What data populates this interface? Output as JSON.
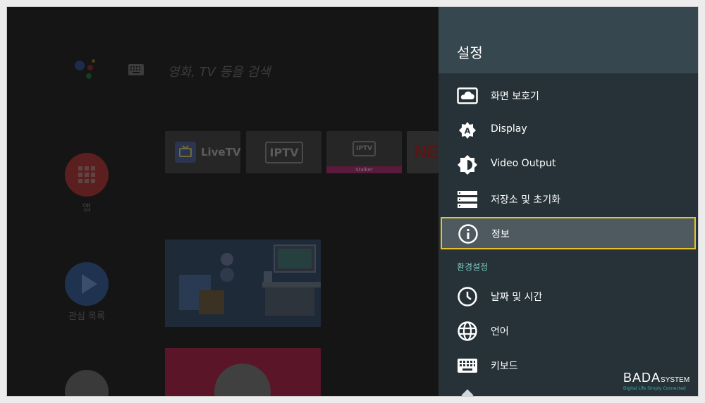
{
  "home": {
    "search_placeholder": "영화, TV 등을 검색",
    "apps_label": "앱",
    "favorites_label": "관심 목록",
    "tiles": {
      "livetv": "LiveTV",
      "iptv": "IPTV",
      "stalker_logo": "IPTV",
      "stalker_label": "Stalker",
      "netflix": "NETF"
    }
  },
  "settings": {
    "title": "설정",
    "items": [
      {
        "label": "화면 보호기",
        "icon": "screensaver-icon"
      },
      {
        "label": "Display",
        "icon": "display-icon"
      },
      {
        "label": "Video Output",
        "icon": "brightness-icon"
      },
      {
        "label": "저장소 및 초기화",
        "icon": "storage-icon"
      },
      {
        "label": "정보",
        "icon": "info-icon",
        "focused": true
      }
    ],
    "section_label": "환경설정",
    "pref_items": [
      {
        "label": "날짜 및 시간",
        "icon": "clock-icon"
      },
      {
        "label": "언어",
        "icon": "globe-icon"
      },
      {
        "label": "키보드",
        "icon": "keyboard-icon"
      }
    ]
  },
  "brand": {
    "name": "BADA",
    "suffix": "SYSTEM",
    "tagline": "Digital Life Simply Connected"
  },
  "colors": {
    "panel_bg": "#263238",
    "panel_header": "#37474f",
    "focus_border": "#e8c228",
    "section_label": "#80cbc4"
  }
}
